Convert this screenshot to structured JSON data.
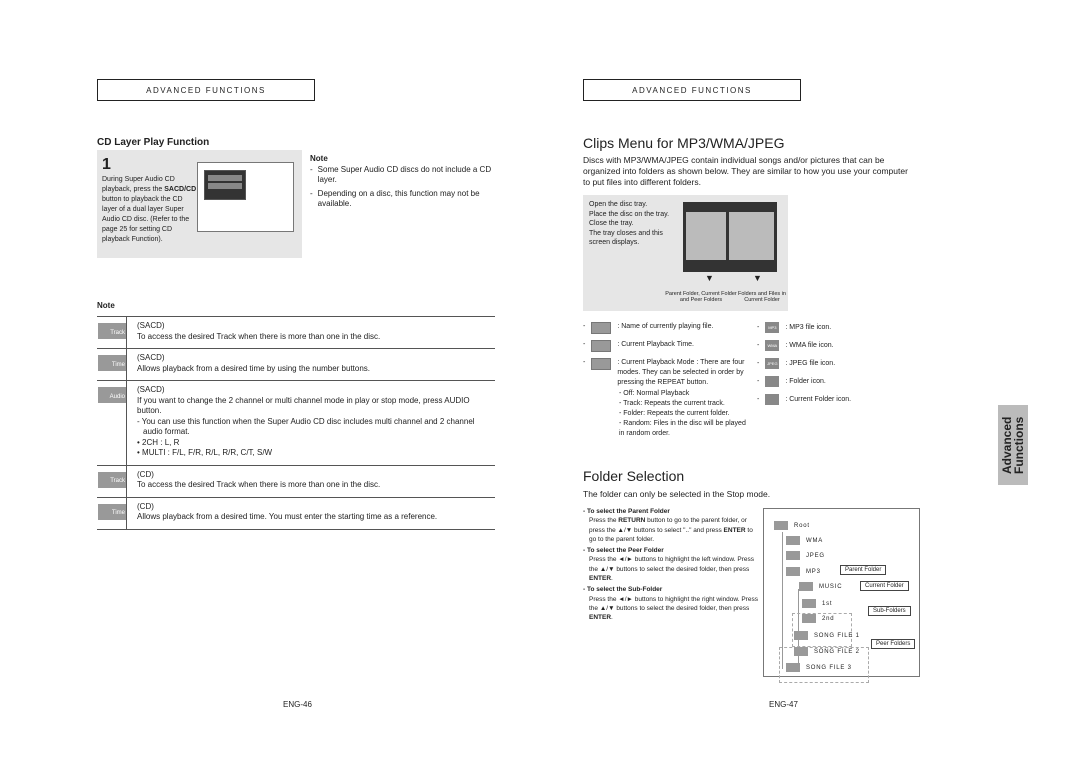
{
  "left": {
    "header": "Advanced Functions",
    "section_title": "CD Layer Play Function",
    "step": {
      "number": "1",
      "text_before": "During Super Audio CD playback, press the ",
      "bold": "SACD/CD",
      "text_after": " button to playback the CD layer of a dual layer Super Audio CD disc. (Refer to the page 25 for setting CD playback Function)."
    },
    "note": {
      "title": "Note",
      "items": [
        "Some Super Audio CD discs do not include a CD layer.",
        "Depending on a disc, this function may not be available."
      ]
    },
    "note2_title": "Note",
    "rows": [
      {
        "icon": "track-icon",
        "icon_label": "Track",
        "mode": "(SACD)",
        "lines": [
          "To access the desired Track when there is more than one in the disc."
        ]
      },
      {
        "icon": "time-icon",
        "icon_label": "Time",
        "mode": "(SACD)",
        "lines": [
          "Allows playback from a desired time by using the number buttons."
        ]
      },
      {
        "icon": "audio-icon",
        "icon_label": "Audio",
        "mode": "(SACD)",
        "lines": [
          "If you want to change the 2 channel or multi channel mode in play or stop mode, press AUDIO button.",
          "- You can use this function when the Super Audio CD disc includes multi channel and 2 channel audio format.",
          "• 2CH : L, R",
          "• MULTI : F/L, F/R, R/L, R/R, C/T, S/W"
        ]
      },
      {
        "icon": "track-icon",
        "icon_label": "Track",
        "mode": "(CD)",
        "lines": [
          "To access the desired Track when there is more than one in the disc."
        ]
      },
      {
        "icon": "time-icon",
        "icon_label": "Time",
        "mode": "(CD)",
        "lines": [
          "Allows playback from a desired time. You must enter the starting time as a reference."
        ]
      }
    ],
    "page": "ENG-46"
  },
  "right": {
    "header": "Advanced Functions",
    "title": "Clips Menu for MP3/WMA/JPEG",
    "intro": "Discs with MP3/WMA/JPEG contain individual songs and/or pictures that can be organized into folders as shown below. They are similar to how you use your computer to put files into different folders.",
    "tray_steps": [
      "Open the disc tray.",
      "Place the disc on the tray.",
      "Close the tray.",
      "The tray closes and this screen displays."
    ],
    "screen_caption_left": "Parent Folder, Current Folder and Peer Folders",
    "screen_caption_right": "Folders and Files in Current Folder",
    "icons_left": [
      {
        "icon": "file-name-icon",
        "text": ": Name of currently playing file."
      },
      {
        "icon": "playback-time-icon",
        "text": ": Current Playback Time."
      },
      {
        "icon": "playback-mode-icon",
        "text": ": Current Playback Mode : There are four modes. They can be selected in order by pressing the REPEAT button."
      }
    ],
    "modes": [
      "- Off: Normal Playback",
      "- Track: Repeats the current track.",
      "- Folder: Repeats the current folder.",
      "- Random: Files in the disc will be played in random order."
    ],
    "icons_right": [
      {
        "icon": "mp3-icon",
        "badge": "MP3",
        "text": ": MP3 file icon."
      },
      {
        "icon": "wma-icon",
        "badge": "WMA",
        "text": ": WMA file icon."
      },
      {
        "icon": "jpeg-icon",
        "badge": "JPEG",
        "text": ": JPEG file icon."
      },
      {
        "icon": "folder-icon",
        "badge": "",
        "text": ": Folder icon."
      },
      {
        "icon": "current-folder-icon",
        "badge": "",
        "text": ": Current Folder icon."
      }
    ],
    "folder_title": "Folder Selection",
    "folder_sub": "The folder can only be selected in the Stop mode.",
    "instructions": [
      {
        "title": "To select the Parent Folder",
        "text": "Press the RETURN button to go to the parent folder, or press the ▲/▼ buttons to select \"..\" and press ENTER to go to the parent folder."
      },
      {
        "title": "To select the Peer Folder",
        "text": "Press the ◄/► buttons to highlight the left window. Press the ▲/▼ buttons to select the desired folder, then press ENTER."
      },
      {
        "title": "To select the Sub-Folder",
        "text": "Press the ◄/► buttons to highlight the right window. Press the ▲/▼ buttons to select the desired folder, then press ENTER."
      }
    ],
    "tree": {
      "nodes": [
        "Root",
        "WMA",
        "JPEG",
        "MP3",
        "MUSIC",
        "1st",
        "2nd",
        "SONG FILE 1",
        "SONG FILE 2",
        "SONG FILE 3"
      ],
      "labels": [
        "Parent Folder",
        "Current Folder",
        "Sub-Folders",
        "Peer Folders"
      ]
    },
    "side_tab": "Advanced Functions",
    "page": "ENG-47"
  }
}
